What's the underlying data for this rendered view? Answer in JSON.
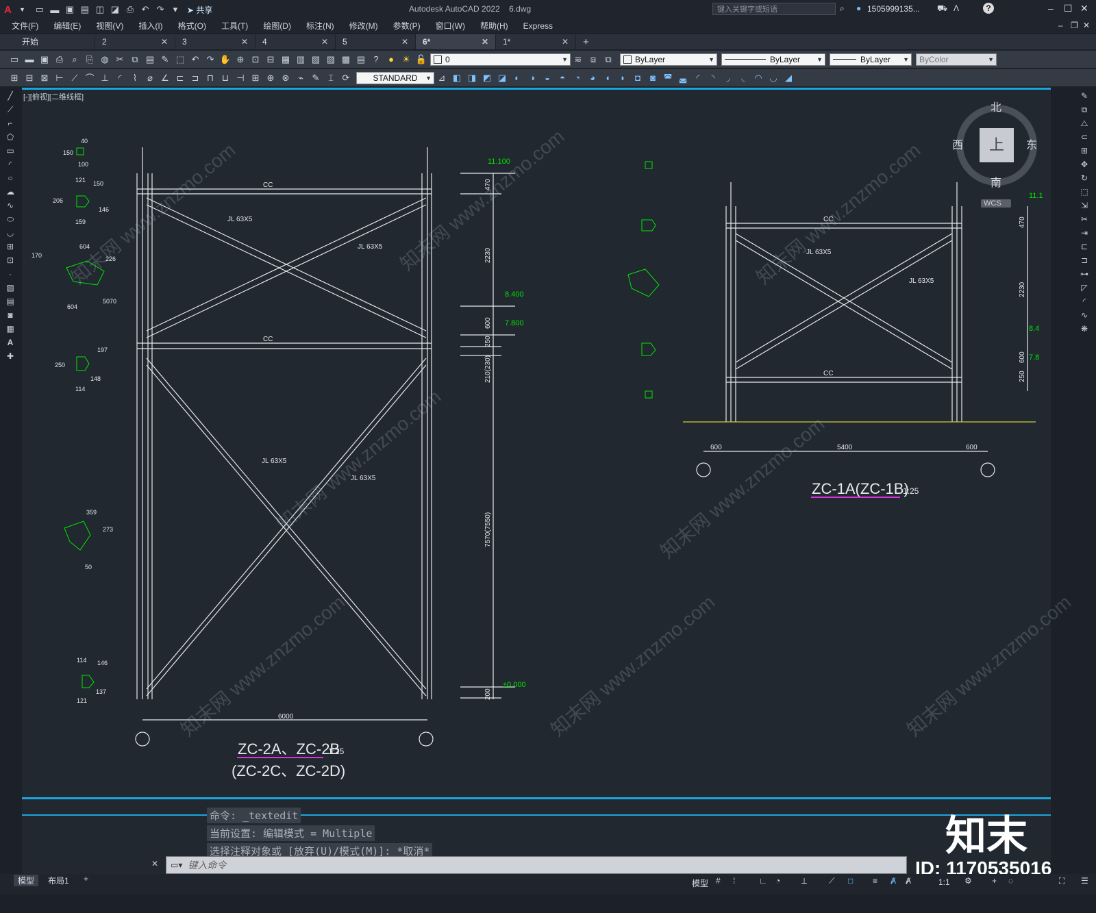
{
  "app": {
    "title": "Autodesk AutoCAD 2022",
    "file": "6.dwg",
    "share": "共享",
    "search_placeholder": "键入关键字或短语",
    "user": "1505999135...",
    "window_buttons": [
      "–",
      "☐",
      "✕"
    ]
  },
  "menu": [
    "文件(F)",
    "编辑(E)",
    "视图(V)",
    "插入(I)",
    "格式(O)",
    "工具(T)",
    "绘图(D)",
    "标注(N)",
    "修改(M)",
    "参数(P)",
    "窗口(W)",
    "帮助(H)",
    "Express"
  ],
  "tabs": [
    {
      "label": "开始",
      "active": false
    },
    {
      "label": "2",
      "active": false
    },
    {
      "label": "3",
      "active": false
    },
    {
      "label": "4",
      "active": false
    },
    {
      "label": "5",
      "active": false
    },
    {
      "label": "6*",
      "active": true
    },
    {
      "label": "1*",
      "active": false
    }
  ],
  "toolbar": {
    "layer_value": "0",
    "color": "ByLayer",
    "linetype": "ByLayer",
    "lineweight": "ByLayer",
    "plotstyle": "ByColor",
    "textstyle": "STANDARD"
  },
  "viewport": {
    "label": "[-][俯视][二维线框]",
    "viewcube": {
      "north": "北",
      "south": "南",
      "east": "东",
      "west": "西",
      "top": "上",
      "wcs": "WCS"
    }
  },
  "drawing": {
    "left": {
      "member_top": "CC",
      "member_mid": "CC",
      "brace": "JL 63X5",
      "elev": [
        "11.100",
        "8.400",
        "7.800",
        "±0.000"
      ],
      "dims_v": [
        "470",
        "2230",
        "600",
        "250",
        "210(230)",
        "7570(7550)",
        "200"
      ],
      "dim_h": "6000",
      "title": "ZC-2A、ZC-2B",
      "scale": "1:25",
      "subtitle": "(ZC-2C、ZC-2D)",
      "plate_dims": [
        "40",
        "150",
        "100",
        "121",
        "150",
        "206",
        "159",
        "146",
        "604",
        "170",
        "226",
        "50",
        "70",
        "604",
        "197",
        "250",
        "114",
        "148",
        "359",
        "273",
        "50",
        "121",
        "137",
        "114",
        "146"
      ]
    },
    "right": {
      "member_top": "CC",
      "member_bot": "CC",
      "brace": "JL 63X5",
      "elev": [
        "11.1",
        "8.4",
        "7.8"
      ],
      "dims_v": [
        "470",
        "2230",
        "600",
        "250"
      ],
      "dims_h": [
        "600",
        "5400",
        "600"
      ],
      "title": "ZC-1A(ZC-1B)",
      "scale": "1:25"
    }
  },
  "command": {
    "history": [
      "命令: _textedit",
      "当前设置: 编辑模式 = Multiple",
      "选择注释对象或 [放弃(U)/模式(M)]: *取消*"
    ],
    "placeholder": "键入命令"
  },
  "status": {
    "tabs": [
      "模型",
      "布局1"
    ],
    "mode": "模型",
    "scale": "1:1"
  },
  "overlay": {
    "brand": "知末",
    "id": "ID: 1170535016",
    "watermark": "知末网 www.znzmo.com"
  },
  "colors": {
    "accent": "#1ba6e0",
    "dim_green": "#00e600",
    "canvas": "#212830",
    "title_underline": "#e030e0"
  }
}
